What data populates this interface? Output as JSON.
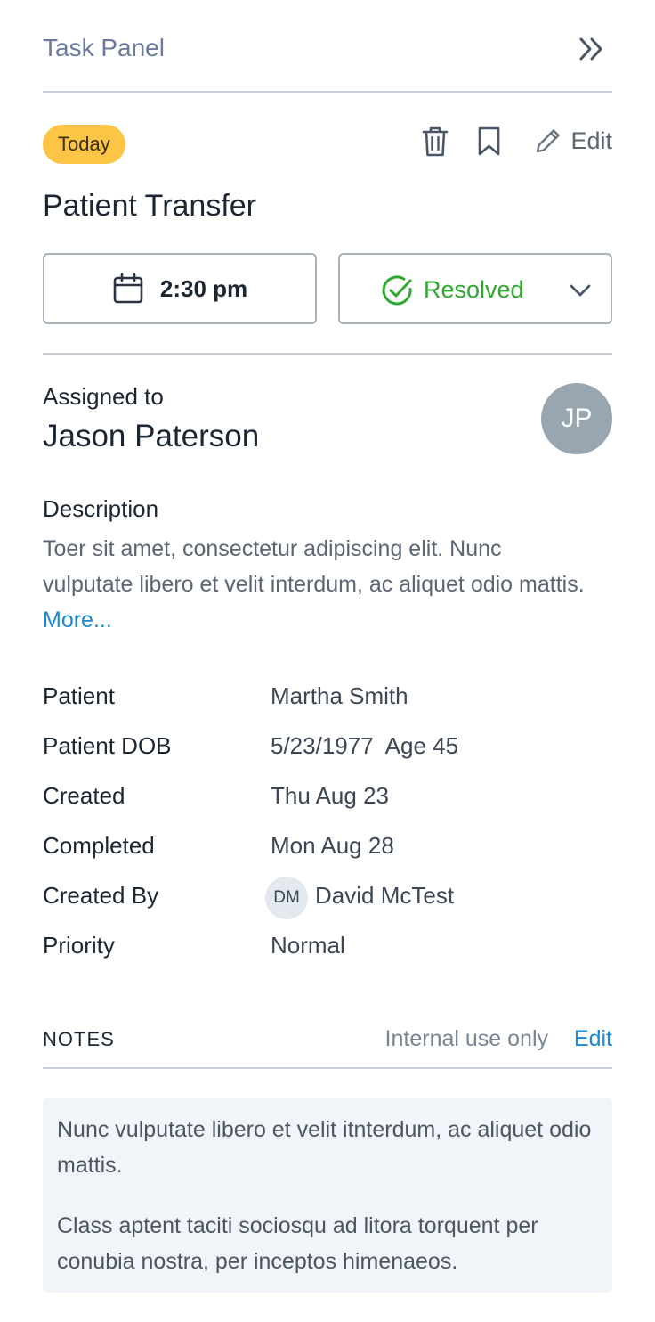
{
  "header": {
    "title": "Task Panel"
  },
  "task": {
    "badge": "Today",
    "edit_label": "Edit",
    "title": "Patient Transfer",
    "time": "2:30 pm",
    "status": "Resolved"
  },
  "assignee": {
    "label": "Assigned to",
    "name": "Jason Paterson",
    "initials": "JP"
  },
  "description": {
    "label": "Description",
    "text": "Toer sit amet, consectetur adipiscing elit. Nunc vulputate libero et velit interdum, ac aliquet odio mattis. ",
    "more": "More..."
  },
  "details": {
    "patient": {
      "label": "Patient",
      "value": "Martha Smith"
    },
    "dob": {
      "label": "Patient DOB",
      "value": "5/23/1977  Age 45"
    },
    "created": {
      "label": "Created",
      "value": "Thu Aug 23"
    },
    "completed": {
      "label": "Completed",
      "value": "Mon Aug 28"
    },
    "created_by": {
      "label": "Created By",
      "initials": "DM",
      "value": "David McTest"
    },
    "priority": {
      "label": "Priority",
      "value": "Normal"
    }
  },
  "notes": {
    "title": "NOTES",
    "hint": "Internal use only",
    "edit_label": "Edit",
    "paragraphs": [
      "Nunc vulputate libero et velit itnterdum, ac aliquet odio mattis.",
      "Class aptent taciti sociosqu ad litora torquent per conubia nostra, per inceptos himenaeos."
    ]
  },
  "colors": {
    "badge": "#fdc545",
    "resolved": "#2fa82f",
    "link": "#1b8ad4",
    "avatar": "#98a6b1",
    "notes_bg": "#f1f5f9"
  },
  "icons": [
    "double-chevron-right-icon",
    "trash-icon",
    "bookmark-icon",
    "pencil-icon",
    "calendar-icon",
    "check-circle-icon",
    "chevron-down-icon"
  ]
}
